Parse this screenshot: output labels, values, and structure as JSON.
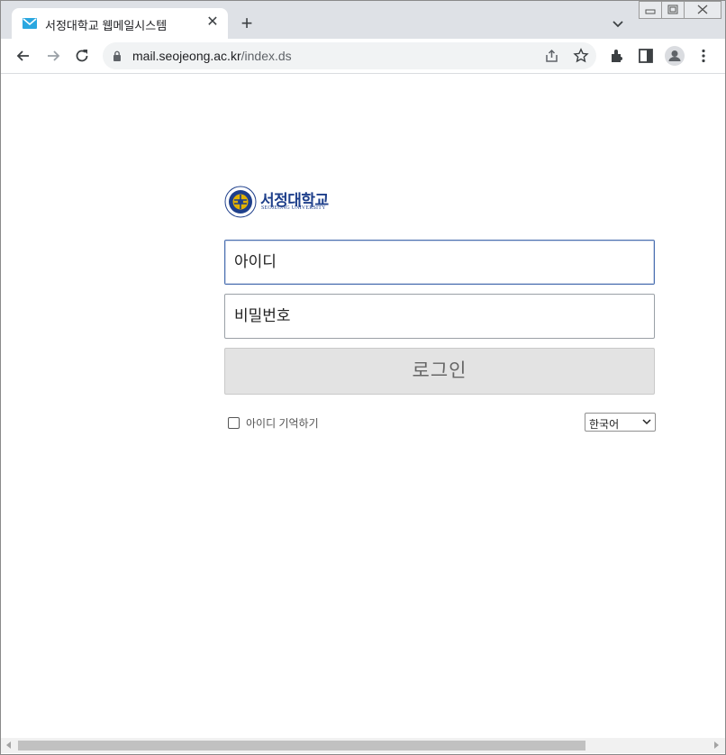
{
  "browser": {
    "tab": {
      "title": "서정대학교 웹메일시스템",
      "favicon": "mail-icon",
      "close_glyph": "✕"
    },
    "new_tab_glyph": "+",
    "url": {
      "host": "mail.seojeong.ac.kr",
      "path": "/index.ds"
    },
    "icons": [
      "back-arrow-icon",
      "forward-arrow-icon",
      "reload-icon",
      "lock-icon",
      "share-icon",
      "star-icon",
      "extensions-icon",
      "side-panel-icon",
      "profile-icon",
      "menu-icon"
    ]
  },
  "login": {
    "logo": {
      "name_ko": "서정대학교",
      "name_en": "SEOJEONG UNIVERSITY"
    },
    "id_placeholder": "아이디",
    "password_placeholder": "비밀번호",
    "login_label": "로그인",
    "remember_label": "아이디 기억하기",
    "remember_checked": false,
    "language_selected": "한국어"
  },
  "colors": {
    "brand": "#1e3f8b",
    "button_bg": "#e3e3e3",
    "focus_border": "#4a6fb0"
  }
}
